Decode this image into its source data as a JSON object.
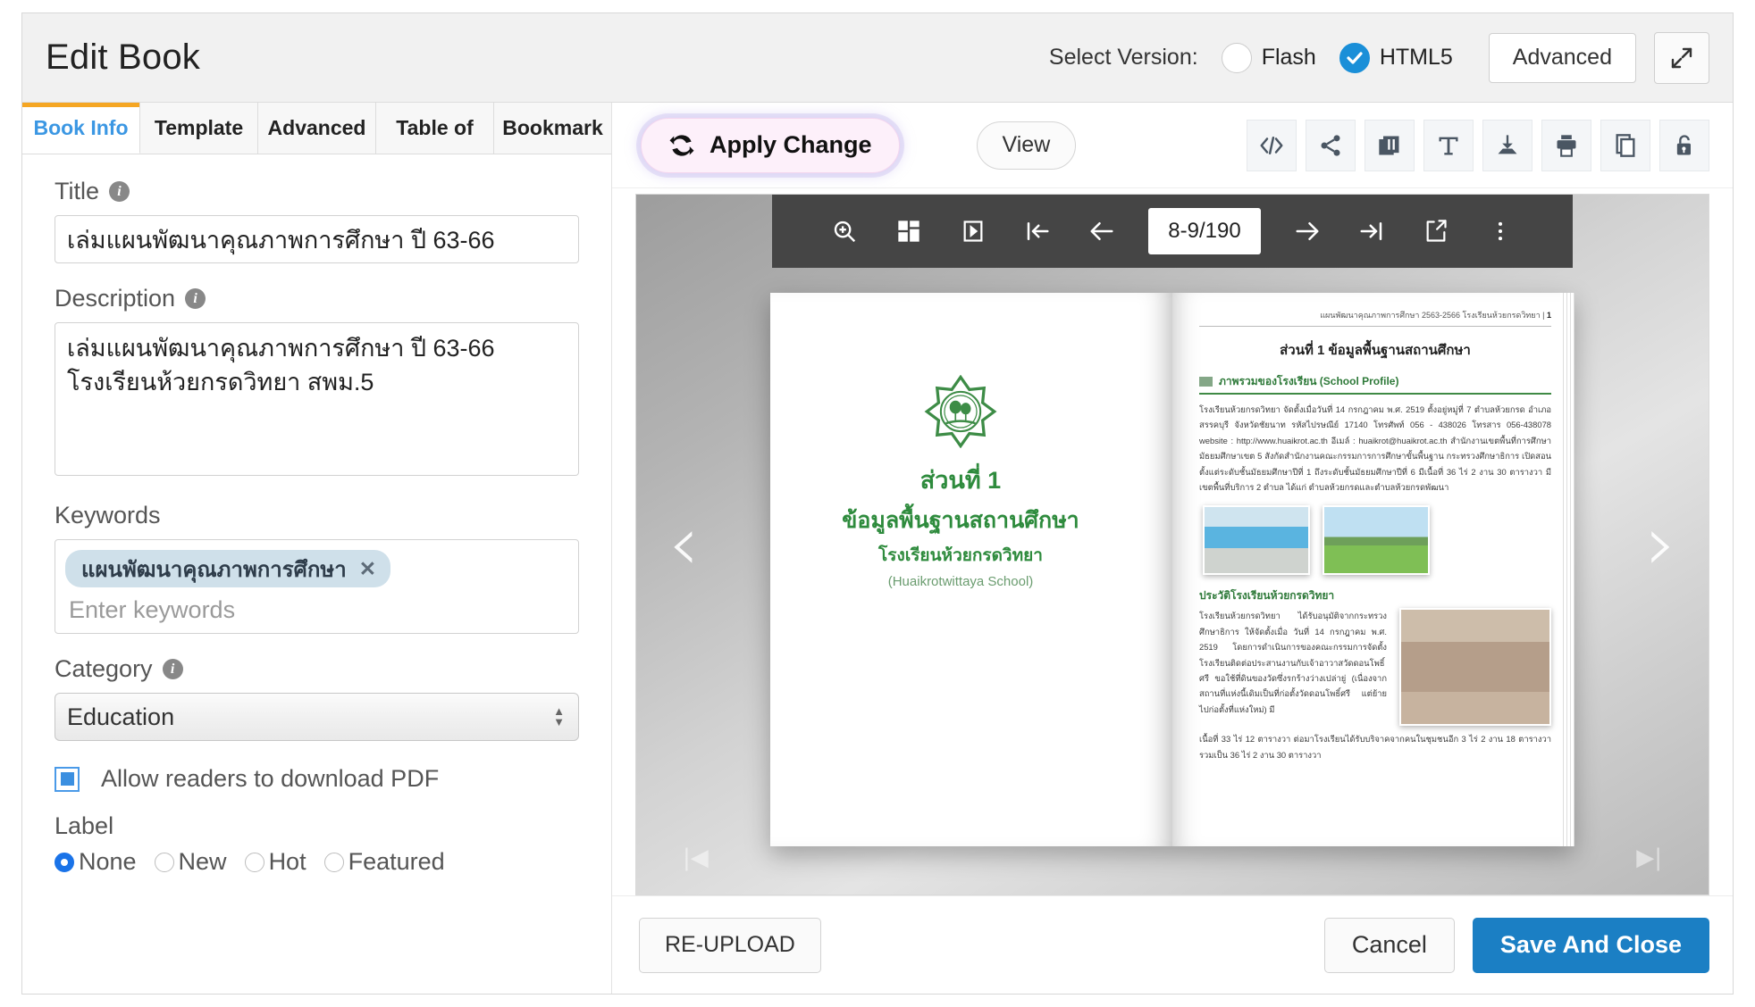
{
  "header": {
    "title": "Edit Book",
    "select_version_label": "Select Version:",
    "options": [
      {
        "label": "Flash",
        "selected": false
      },
      {
        "label": "HTML5",
        "selected": true
      }
    ],
    "advanced_label": "Advanced",
    "expand_icon": "expand-icon"
  },
  "tabs": [
    {
      "label": "Book Info",
      "active": true
    },
    {
      "label": "Template",
      "active": false
    },
    {
      "label": "Advanced",
      "active": false
    },
    {
      "label": "Table of",
      "active": false
    },
    {
      "label": "Bookmark",
      "active": false
    }
  ],
  "form": {
    "title": {
      "label": "Title",
      "value": "เล่มแผนพัฒนาคุณภาพการศึกษา ปี 63-66",
      "info": "info-icon"
    },
    "description": {
      "label": "Description",
      "value": "เล่มแผนพัฒนาคุณภาพการศึกษา ปี 63-66\nโรงเรียนห้วยกรดวิทยา สพม.5",
      "info": "info-icon"
    },
    "keywords": {
      "label": "Keywords",
      "tags": [
        "แผนพัฒนาคุณภาพการศึกษา"
      ],
      "remove_icon": "close-icon",
      "placeholder": "Enter keywords"
    },
    "category": {
      "label": "Category",
      "value": "Education",
      "info": "info-icon"
    },
    "allow_download": {
      "label": "Allow readers to download PDF",
      "checked": true
    },
    "label_group": {
      "label": "Label",
      "options": [
        {
          "label": "None",
          "selected": true
        },
        {
          "label": "New",
          "selected": false
        },
        {
          "label": "Hot",
          "selected": false
        },
        {
          "label": "Featured",
          "selected": false
        }
      ]
    }
  },
  "viewer_toolbar": {
    "apply_label": "Apply Change",
    "apply_icon": "sync-icon",
    "view_label": "View",
    "icons": [
      "embed-code-icon",
      "share-icon",
      "bookcase-icon",
      "text-icon",
      "download-icon",
      "print-icon",
      "copy-icon",
      "lock-icon"
    ]
  },
  "flipbook": {
    "toolbar_icons_left": [
      "zoom-in-icon",
      "thumbnails-icon",
      "slideshow-icon",
      "first-page-icon",
      "prev-page-icon"
    ],
    "page_indicator": "8-9/190",
    "toolbar_icons_right": [
      "next-page-icon",
      "last-page-icon",
      "share-out-icon",
      "more-options-icon"
    ],
    "prev_arrow": "chevron-left-icon",
    "next_arrow": "chevron-right-icon",
    "corner_first": "first-page-corner-icon",
    "corner_last": "last-page-corner-icon",
    "left_page": {
      "crest": "school-crest-icon",
      "line1": "ส่วนที่ 1",
      "line2": "ข้อมูลพื้นฐานสถานศึกษา",
      "line3": "โรงเรียนห้วยกรดวิทยา",
      "line4": "(Huaikrotwittaya School)"
    },
    "right_page": {
      "running_head": "แผนพัฒนาคุณภาพการศึกษา 2563-2566  โรงเรียนห้วยกรดวิทยา |",
      "page_number": "1",
      "title": "ส่วนที่ 1 ข้อมูลพื้นฐานสถานศึกษา",
      "section1_heading": "ภาพรวมของโรงเรียน (School Profile)",
      "section1_body": "โรงเรียนห้วยกรดวิทยา จัดตั้งเมื่อวันที่ 14 กรกฎาคม พ.ศ. 2519 ตั้งอยู่หมู่ที่ 7 ตำบลห้วยกรด อำเภอสรรคบุรี จังหวัดชัยนาท รหัสไปรษณีย์ 17140 โทรศัพท์ 056 - 438026 โทรสาร 056-438078 website : http://www.huaikrot.ac.th อีเมล์ : huaikrot@huaikrot.ac.th สำนักงานเขตพื้นที่การศึกษามัธยมศึกษาเขต 5 สังกัดสำนักงานคณะกรรมการการศึกษาขั้นพื้นฐาน กระทรวงศึกษาธิการ เปิดสอนตั้งแต่ระดับชั้นมัธยมศึกษาปีที่ 1 ถึงระดับชั้นมัธยมศึกษาปีที่ 6 มีเนื้อที่ 36 ไร่ 2 งาน 30 ตารางวา มีเขตพื้นที่บริการ 2 ตำบล ได้แก่ ตำบลห้วยกรดและตำบลห้วยกรดพัฒนา",
      "photo1": "school-building-photo",
      "photo2": "school-field-photo",
      "section2_heading": "ประวัติโรงเรียนห้วยกรดวิทยา",
      "section2_body": "โรงเรียนห้วยกรดวิทยา ได้รับอนุมัติจากกระทรวงศึกษาธิการ ให้จัดตั้งเมื่อ วันที่ 14 กรกฎาคม พ.ศ. 2519 โดยการดำเนินการของคณะกรรมการจัดตั้งโรงเรียนติดต่อประสานงานกับเจ้าอาวาสวัดดอนโพธิ์ศรี ขอใช้ที่ดินของวัดซึ่งรกร้างว่างเปล่ายู่ (เนื่องจากสถานที่แห่งนี้เดิมเป็นที่ก่อตั้งวัดดอนโพธิ์ศรี แต่ย้ายไปก่อตั้งที่แห่งใหม่) มี",
      "photo3": "school-class-photo",
      "section2_body_cont": "เนื้อที่ 33 ไร่ 12 ตารางวา ต่อมาโรงเรียนได้รับบริจาคจากคนในชุมชนอีก 3 ไร่ 2 งาน 18 ตารางวา รวมเป็น 36 ไร่ 2 งาน 30 ตารางวา"
    }
  },
  "footer": {
    "reupload_label": "RE-UPLOAD",
    "cancel_label": "Cancel",
    "save_label": "Save And Close"
  },
  "colors": {
    "accent_blue": "#1b7fc4",
    "tab_active_underline": "#f5a623",
    "tab_active_text": "#3b97e3",
    "keyword_tag_bg": "#cfe0ea",
    "page_green": "#2e8b3d"
  }
}
